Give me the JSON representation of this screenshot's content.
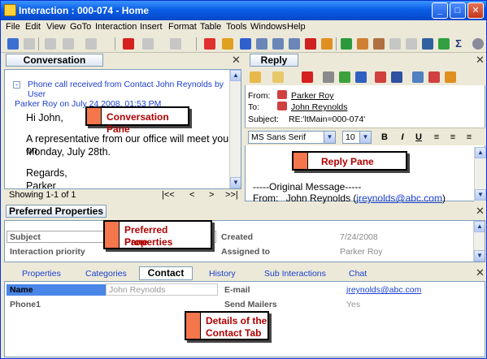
{
  "window": {
    "title": "Interaction : 000-074 - Home"
  },
  "menu": [
    "File",
    "Edit",
    "View",
    "GoTo",
    "Interaction",
    "Insert",
    "Format",
    "Table",
    "Tools",
    "Windows",
    "Help"
  ],
  "conversation": {
    "tab_label": "Conversation",
    "header_line1": "Phone call received from Contact John Reynolds by User",
    "header_line2": "Parker Roy on July 24 2008, 01:53 PM",
    "greeting": "Hi John,",
    "body1": "A representative from our office will meet you on",
    "body2": "Monday, July 28th.",
    "closing": "Regards,",
    "signature": "Parker",
    "status": "Showing 1-1 of 1",
    "nav": [
      "|<<",
      "<",
      ">",
      ">>|"
    ]
  },
  "reply": {
    "tab_label": "Reply",
    "from_label": "From:",
    "from_value": "Parker Roy",
    "to_label": "To:",
    "to_value": "John Reynolds",
    "subject_label": "Subject:",
    "subject_value": "RE:'ltMain=000-074'",
    "font_name": "MS Sans Serif",
    "font_size": "10",
    "bold": "B",
    "italic": "I",
    "underline": "U",
    "original_message": "-----Original Message-----",
    "orig_from_label": "From:",
    "orig_from_name": "John Reynolds (",
    "orig_from_email": "jreynolds@abc.com",
    "orig_from_close": ")"
  },
  "preferred": {
    "tab_label": "Preferred Properties",
    "subject_label": "Subject",
    "priority_label": "Interaction priority",
    "created_label": "Created",
    "created_value": "7/24/2008",
    "assigned_label": "Assigned to",
    "assigned_value": "Parker Roy"
  },
  "details": {
    "tabs": [
      "Properties",
      "Categories",
      "Contact",
      "History",
      "Sub Interactions",
      "Chat"
    ],
    "active_tab": "Contact",
    "name_label": "Name",
    "name_value": "John Reynolds",
    "phone_label": "Phone1",
    "email_label": "E-mail",
    "email_value": "jreynolds@abc.com",
    "mailers_label": "Send Mailers",
    "mailers_value": "Yes"
  },
  "callouts": {
    "conversation": "Conversation Pane",
    "reply": "Reply Pane",
    "preferred_line1": "Preferred Properties",
    "preferred_line2": "Pane",
    "details_line1": "Details of the",
    "details_line2": "Contact Tab"
  },
  "colors": {
    "accent": "#f4764d",
    "callout_text": "#b00000",
    "link": "#1a3fcf",
    "title_bar": "#0a5ee5"
  }
}
